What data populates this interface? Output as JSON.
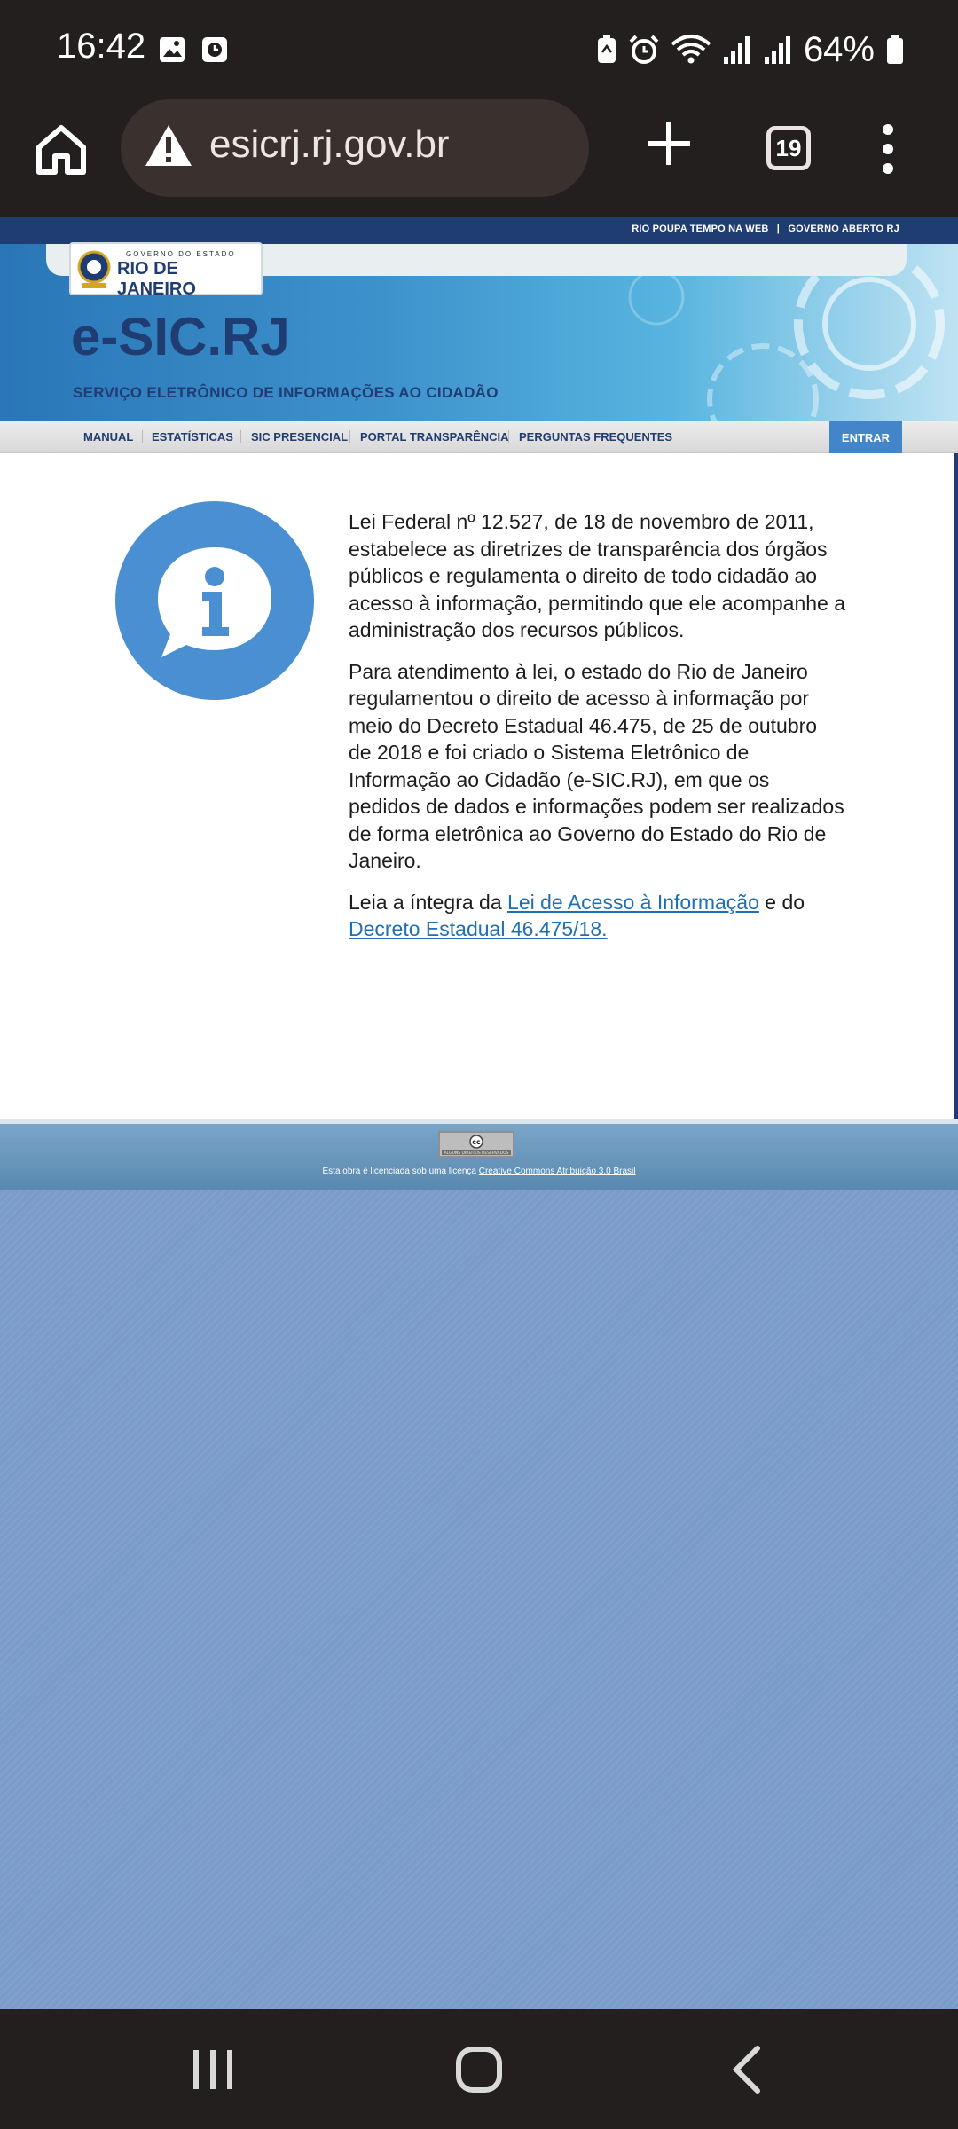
{
  "status_bar": {
    "time": "16:42",
    "battery": "64%",
    "icons": [
      "gallery-icon",
      "clock-app-icon",
      "battery-saver-icon",
      "alarm-icon",
      "wifi-icon",
      "signal-icon",
      "signal-icon-2",
      "battery-icon"
    ]
  },
  "browser": {
    "url": "esicrj.rj.gov.br",
    "tab_count": "19",
    "icons": [
      "home-icon",
      "warning-icon",
      "plus-icon",
      "tabs-icon",
      "menu-dots-icon"
    ]
  },
  "site": {
    "top_links": [
      "RIO POUPA TEMPO NA WEB",
      "|",
      "GOVERNO ABERTO RJ"
    ],
    "logo_small": "GOVERNO DO ESTADO",
    "logo_big": "RIO DE JANEIRO",
    "banner_title": "e-SIC.RJ",
    "banner_subtitle": "SERVIÇO ELETRÔNICO DE INFORMAÇÕES AO CIDADÃO",
    "nav": [
      "MANUAL",
      "ESTATÍSTICAS",
      "SIC PRESENCIAL",
      "PORTAL TRANSPARÊNCIA",
      "PERGUNTAS FREQUENTES"
    ],
    "login_label": "ENTRAR",
    "accent_color": "#4285c8",
    "brand_color": "#1f3c73"
  },
  "content": {
    "p1": "Lei Federal nº 12.527, de 18 de novembro de 2011, estabelece as diretrizes de transparência dos órgãos públicos e regulamenta o direito de todo cidadão ao acesso à informação, permitindo que ele acompanhe a administração dos recursos públicos.",
    "p2": "Para atendimento à lei, o estado do Rio de Janeiro regulamentou o direito de acesso à informação por meio do Decreto Estadual 46.475, de 25 de outubro de 2018 e foi criado o Sistema Eletrônico de Informação ao Cidadão (e-SIC.RJ), em que os pedidos de dados e informações podem ser realizados de forma eletrônica ao Governo do Estado do Rio de Janeiro.",
    "p3_prefix": "Leia a íntegra da ",
    "link1": "Lei de Acesso à Informação",
    "p3_middle": " e do ",
    "link2": "Decreto Estadual 46.475/18."
  },
  "footer": {
    "cc_badge": "cc",
    "cc_small": "ALGUNS DIREITOS RESERVADOS",
    "text": "Esta obra é licenciada sob uma licença ",
    "link": "Creative Commons Atribuição 3.0 Brasil"
  },
  "android_nav": [
    "recents-icon",
    "home-circle-icon",
    "back-icon"
  ]
}
